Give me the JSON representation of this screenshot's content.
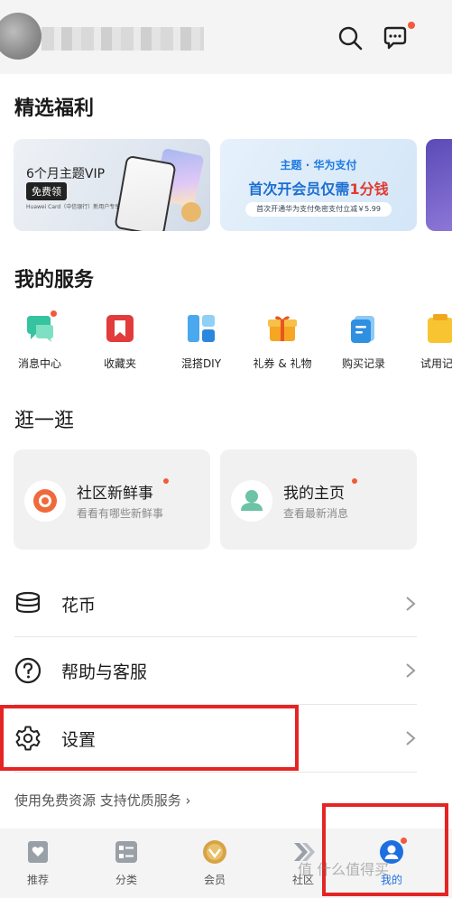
{
  "header": {
    "icons": [
      "search-icon",
      "message-icon"
    ]
  },
  "sections": {
    "welfare_title": "精选福利",
    "services_title": "我的服务",
    "browse_title": "逛一逛"
  },
  "banners": {
    "vip": {
      "title": "6个月主题VIP",
      "badge": "免费领",
      "sub": "Huawei Card（中信银行）新用户专享"
    },
    "pay": {
      "top": "主题 · 华为支付",
      "main_prefix": "首次开会员仅需",
      "main_highlight": "1分钱",
      "sub": "首次开通华为支付免密支付立减￥5.99"
    }
  },
  "services": [
    {
      "label": "消息中心",
      "icon": "message-center-icon"
    },
    {
      "label": "收藏夹",
      "icon": "favorites-icon"
    },
    {
      "label": "混搭DIY",
      "icon": "mix-diy-icon"
    },
    {
      "label": "礼券 & 礼物",
      "icon": "gift-icon"
    },
    {
      "label": "购买记录",
      "icon": "purchase-record-icon"
    },
    {
      "label": "试用记",
      "icon": "trial-icon"
    }
  ],
  "browse": [
    {
      "title": "社区新鲜事",
      "sub": "看看有哪些新鲜事"
    },
    {
      "title": "我的主页",
      "sub": "查看最新消息"
    }
  ],
  "menu": [
    {
      "label": "花币",
      "icon": "coins-icon"
    },
    {
      "label": "帮助与客服",
      "icon": "help-icon"
    },
    {
      "label": "设置",
      "icon": "settings-icon"
    }
  ],
  "footer": {
    "link": "使用免费资源 支持优质服务 ›"
  },
  "bottom_nav": [
    {
      "label": "推荐"
    },
    {
      "label": "分类"
    },
    {
      "label": "会员"
    },
    {
      "label": "社区"
    },
    {
      "label": "我的"
    }
  ],
  "watermark": "值 什么值得买",
  "colors": {
    "accent_blue": "#1d7be0",
    "badge_red": "#f25a3c",
    "highlight_red": "#e52424"
  }
}
